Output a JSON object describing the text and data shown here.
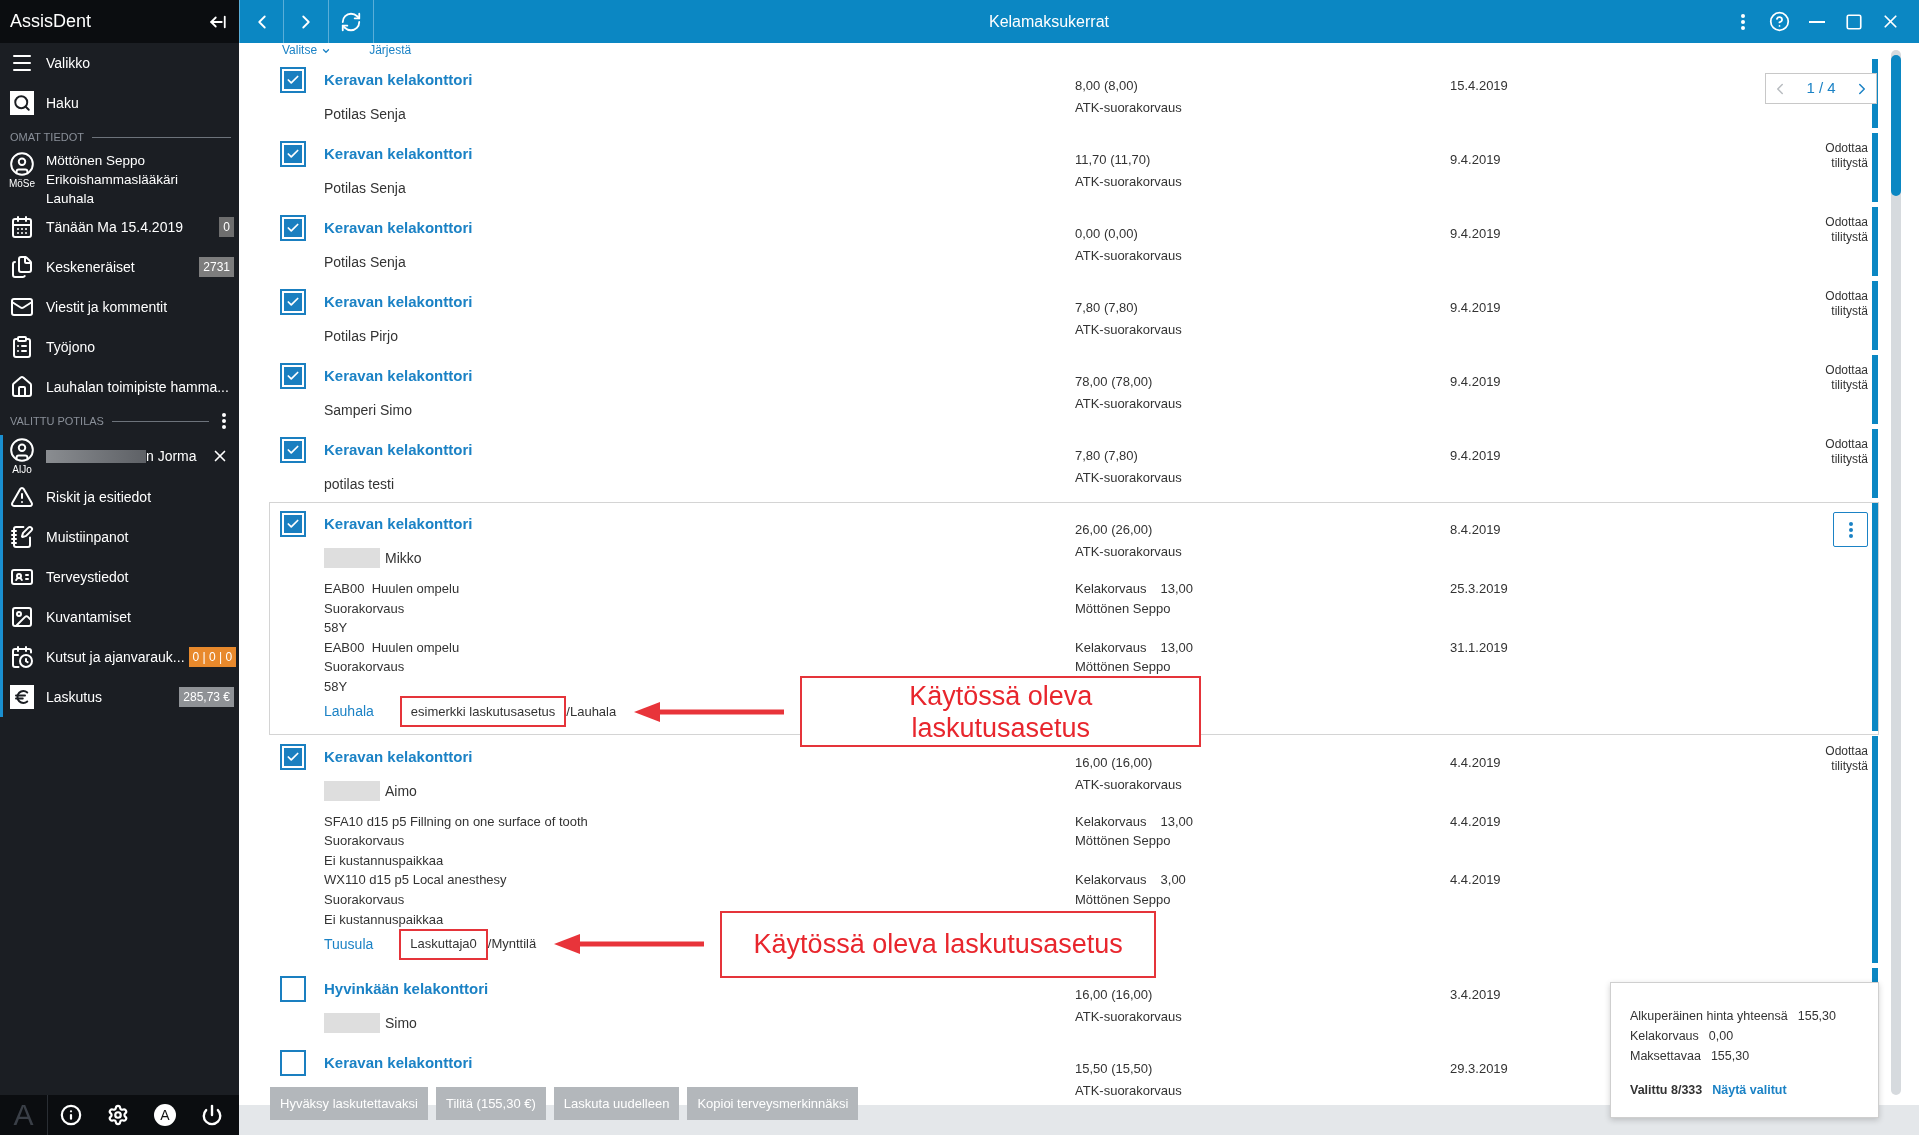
{
  "sidebar": {
    "title": "AssisDent",
    "top_items": [
      {
        "kind": "menu",
        "label": "Valikko"
      },
      {
        "kind": "search",
        "label": "Haku"
      }
    ],
    "own": {
      "heading": "OMAT TIEDOT",
      "user": {
        "initials": "MöSe",
        "name": "Möttönen Seppo",
        "role": "Erikoishammaslääkäri",
        "location": "Lauhala"
      },
      "items": [
        {
          "kind": "calendar",
          "label": "Tänään Ma 15.4.2019",
          "badge": {
            "text": "0",
            "color": "#6e6e6e"
          }
        },
        {
          "kind": "documents",
          "label": "Keskeneräiset",
          "badge": {
            "text": "2731",
            "color": "#7d7d7d"
          }
        },
        {
          "kind": "mail",
          "label": "Viestit ja kommentit"
        },
        {
          "kind": "worklist",
          "label": "Työjono"
        },
        {
          "kind": "home",
          "label": "Lauhalan toimipiste hamma..."
        }
      ]
    },
    "patient": {
      "heading": "VALITTU POTILAS",
      "initials": "AlJo",
      "name": "n Jorma",
      "redacted": true,
      "items": [
        {
          "kind": "warning",
          "label": "Riskit ja esitiedot"
        },
        {
          "kind": "notes",
          "label": "Muistiinpanot"
        },
        {
          "kind": "health",
          "label": "Terveystiedot"
        },
        {
          "kind": "imaging",
          "label": "Kuvantamiset"
        },
        {
          "kind": "appointments",
          "label": "Kutsut ja ajanvarauk...",
          "badge": {
            "text": "0 | 0 | 0",
            "color": "#e8892c"
          }
        },
        {
          "kind": "billing",
          "label": "Laskutus",
          "badge": {
            "text": "285,73 €",
            "color": "#8f9296"
          }
        }
      ]
    },
    "footer": {
      "logo": "A",
      "account": "A"
    }
  },
  "topbar": {
    "title": "Kelamaksukerrat"
  },
  "toolbar": {
    "select": "Valitse",
    "sort": "Järjestä"
  },
  "pager": {
    "page": "1 / 4"
  },
  "rows": [
    {
      "selected": true,
      "focused": false,
      "office": "Keravan kelakonttori",
      "patient": "Potilas Senja",
      "amount": "8,00 (8,00)",
      "type": "ATK-suorakorvaus",
      "date": "15.4.2019"
    },
    {
      "selected": true,
      "focused": false,
      "office": "Keravan kelakonttori",
      "patient": "Potilas Senja",
      "amount": "11,70 (11,70)",
      "type": "ATK-suorakorvaus",
      "date": "9.4.2019",
      "status": "Odottaa tilitystä"
    },
    {
      "selected": true,
      "focused": false,
      "office": "Keravan kelakonttori",
      "patient": "Potilas Senja",
      "amount": "0,00 (0,00)",
      "type": "ATK-suorakorvaus",
      "date": "9.4.2019",
      "status": "Odottaa tilitystä"
    },
    {
      "selected": true,
      "focused": false,
      "office": "Keravan kelakonttori",
      "patient": "Potilas Pirjo",
      "amount": "7,80 (7,80)",
      "type": "ATK-suorakorvaus",
      "date": "9.4.2019",
      "status": "Odottaa tilitystä"
    },
    {
      "selected": true,
      "focused": false,
      "office": "Keravan kelakonttori",
      "patient": "Samperi Simo",
      "amount": "78,00 (78,00)",
      "type": "ATK-suorakorvaus",
      "date": "9.4.2019",
      "status": "Odottaa tilitystä"
    },
    {
      "selected": true,
      "focused": false,
      "office": "Keravan kelakonttori",
      "patient": "potilas testi",
      "amount": "7,80 (7,80)",
      "type": "ATK-suorakorvaus",
      "date": "9.4.2019",
      "status": "Odottaa tilitystä"
    },
    {
      "selected": true,
      "focused": true,
      "office": "Keravan kelakonttori",
      "redacted": true,
      "patient": "Mikko",
      "amount": "26,00 (26,00)",
      "type": "ATK-suorakorvaus",
      "date": "8.4.2019",
      "items": [
        {
          "lines": [
            "EAB00  Huulen ompelu",
            "Suorakorvaus",
            "58Y"
          ],
          "refund_label": "Kelakorvaus",
          "refund": "13,00",
          "provider": "Möttönen Seppo",
          "date": "25.3.2019"
        },
        {
          "lines": [
            "EAB00  Huulen ompelu",
            "Suorakorvaus",
            "58Y"
          ],
          "refund_label": "Kelakorvaus",
          "refund": "13,00",
          "provider": "Möttönen Seppo",
          "date": "31.1.2019"
        }
      ],
      "footer": {
        "location": "Lauhala",
        "setting": "esimerkki laskutusasetus",
        "suffix": "/Lauhala",
        "highlighted": true,
        "callout": {
          "lines": [
            "Käytössä oleva",
            "laskutusasetus"
          ]
        }
      }
    },
    {
      "selected": true,
      "focused": false,
      "office": "Keravan kelakonttori",
      "redacted": true,
      "patient": "Aimo",
      "amount": "16,00 (16,00)",
      "type": "ATK-suorakorvaus",
      "date": "4.4.2019",
      "status": "Odottaa tilitystä",
      "items": [
        {
          "lines": [
            "SFA10 d15 p5 Fillning on one surface of tooth",
            "Suorakorvaus",
            "Ei kustannuspaikkaa"
          ],
          "refund_label": "Kelakorvaus",
          "refund": "13,00",
          "provider": "Möttönen Seppo",
          "date": "4.4.2019"
        },
        {
          "lines": [
            "WX110 d15 p5 Local anesthesy",
            "Suorakorvaus",
            "Ei kustannuspaikkaa"
          ],
          "refund_label": "Kelakorvaus",
          "refund": "3,00",
          "provider": "Möttönen Seppo",
          "date": "4.4.2019"
        }
      ],
      "footer": {
        "location": "Tuusula",
        "setting": "Laskuttaja0",
        "suffix": "/Mynttilä",
        "highlighted": true,
        "callout": {
          "lines": [
            "Käytössä oleva laskutusasetus"
          ]
        }
      }
    },
    {
      "selected": false,
      "focused": false,
      "office": "Hyvinkään kelakonttori",
      "redacted": true,
      "patient": "Simo",
      "amount": "16,00 (16,00)",
      "type": "ATK-suorakorvaus",
      "date": "3.4.2019"
    },
    {
      "selected": false,
      "focused": false,
      "office": "Keravan kelakonttori",
      "amount": "15,50 (15,50)",
      "type": "ATK-suorakorvaus",
      "date": "29.3.2019"
    }
  ],
  "summary": {
    "lines": [
      {
        "label": "Alkuperäinen hinta yhteensä",
        "value": "155,30"
      },
      {
        "label": "Kelakorvaus",
        "value": "0,00"
      },
      {
        "label": "Maksettavaa",
        "value": "155,30"
      }
    ],
    "selected": "Valittu 8/333",
    "link": "Näytä valitut"
  },
  "actions": [
    "Hyväksy laskutettavaksi",
    "Tilitä (155,30 €)",
    "Laskuta uudelleen",
    "Kopioi terveysmerkinnäksi"
  ]
}
